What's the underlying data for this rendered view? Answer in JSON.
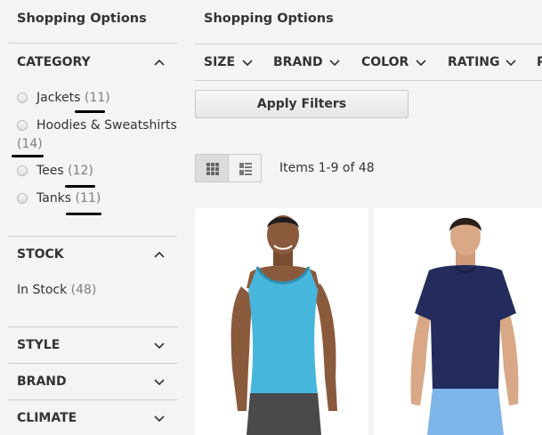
{
  "sidebar": {
    "title": "Shopping Options",
    "category": {
      "heading": "CATEGORY",
      "options": [
        {
          "label": "Jackets",
          "count": "(11)"
        },
        {
          "label": "Hoodies & Sweatshirts",
          "count": "(14)"
        },
        {
          "label": "Tees",
          "count": "(12)"
        },
        {
          "label": "Tanks",
          "count": "(11)"
        }
      ]
    },
    "stock": {
      "heading": "STOCK",
      "option": {
        "label": "In Stock",
        "count": "(48)"
      }
    },
    "collapsed": [
      "STYLE",
      "BRAND",
      "CLIMATE"
    ]
  },
  "main": {
    "title": "Shopping Options",
    "filters": [
      "SIZE",
      "BRAND",
      "COLOR",
      "RATING",
      "P"
    ],
    "apply_label": "Apply Filters",
    "amount": "Items 1-9 of 48"
  },
  "icons": {
    "chevron_up": "chevron-up-icon",
    "chevron_down": "chevron-down-icon",
    "grid": "grid-view-icon",
    "list": "list-view-icon"
  },
  "colors": {
    "background": "#f4f4f4",
    "text": "#333333",
    "count": "#7d7d7d",
    "annotation": "#000000",
    "tank_top": "#46b6dc",
    "tee": "#232c5c",
    "shorts": "#7fb6ea"
  }
}
